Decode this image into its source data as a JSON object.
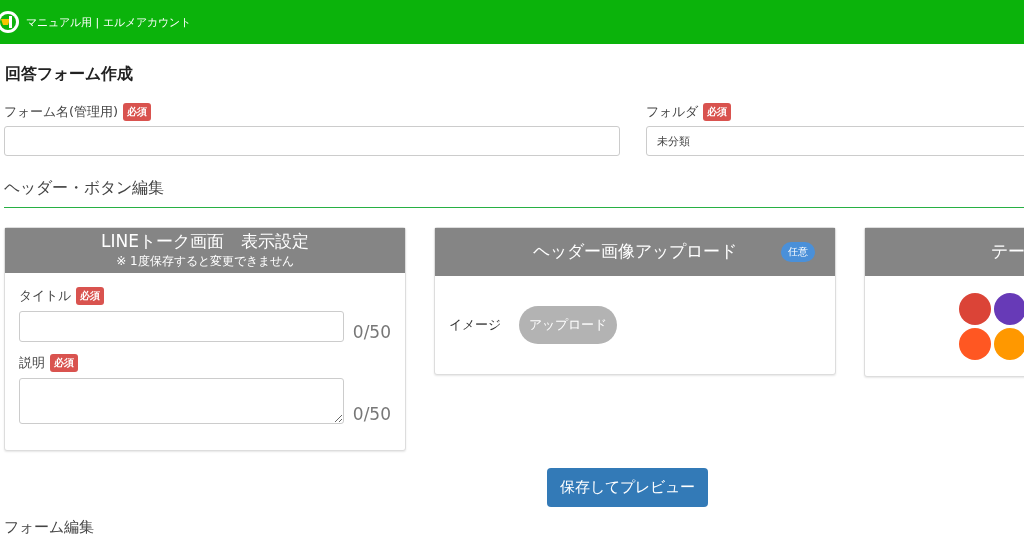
{
  "app_bar": {
    "account": "マニュアル用 | エルメアカウント"
  },
  "page_title": "回答フォーム作成",
  "fields": [
    {
      "label": "フォーム名(管理用)",
      "badge": "必須"
    },
    {
      "label": "フォルダ",
      "badge": "必須",
      "value": "未分類"
    }
  ],
  "section_title": "ヘッダー・ボタン編集",
  "panels": [
    {
      "kind": "line",
      "title": "LINEトーク画面　表示設定",
      "note": "※ 1度保存すると変更できません",
      "inputs": [
        {
          "kind": "input",
          "label": "タイトル",
          "badge": "必須",
          "counter": "0/50"
        },
        {
          "kind": "textarea",
          "label": "説明",
          "badge": "必須",
          "counter": "0/50"
        }
      ]
    },
    {
      "kind": "upload",
      "title": "ヘッダー画像アップロード",
      "badge": "任意",
      "label": "イメージ",
      "button": "アップロード"
    },
    {
      "kind": "colors",
      "title": "テー",
      "colors": [
        {
          "color": "#db4437"
        },
        {
          "color": "#673ab7"
        },
        {
          "color": "#ff5722"
        },
        {
          "color": "#ff9800"
        }
      ]
    }
  ],
  "save_button": "保存してプレビュー",
  "next_section": "フォーム編集"
}
